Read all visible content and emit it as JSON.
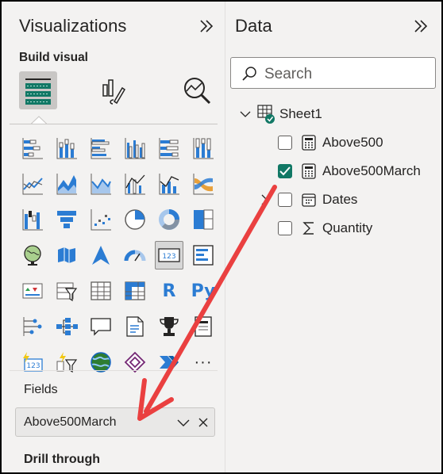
{
  "visualizations_pane": {
    "title": "Visualizations",
    "build_visual_label": "Build visual",
    "build_visual_buttons": [
      {
        "name": "build-visual",
        "icon": "table-fields-icon",
        "selected": true
      },
      {
        "name": "format-visual",
        "icon": "paintbrush-icon",
        "selected": false
      },
      {
        "name": "analytics",
        "icon": "magnifier-analytics-icon",
        "selected": false
      }
    ],
    "visual_types": [
      "stacked-bar-chart",
      "stacked-column-chart",
      "clustered-bar-chart",
      "clustered-column-chart",
      "100-stacked-bar-chart",
      "100-stacked-column-chart",
      "line-chart",
      "area-chart",
      "stacked-area-chart",
      "line-clustered-column-chart",
      "line-stacked-column-chart",
      "ribbon-chart",
      "waterfall-chart",
      "funnel-chart",
      "scatter-chart",
      "pie-chart",
      "donut-chart",
      "treemap",
      "map",
      "filled-map",
      "azure-map",
      "gauge",
      "card",
      "multi-row-card",
      "kpi",
      "slicer",
      "table",
      "matrix",
      "r-visual",
      "python-visual",
      "key-influencers",
      "decomposition-tree",
      "qa",
      "smart-narrative",
      "paginated-report",
      "metrics",
      "power-apps",
      "power-automate",
      "arcgis-map",
      "power-apps-diamond",
      "power-automate-chevron",
      "more-visuals"
    ],
    "r_label": "R",
    "py_label": "Py",
    "card_label": "123",
    "more_label": "···",
    "fields_label": "Fields",
    "field_well_value": "Above500March",
    "drill_through_label": "Drill through"
  },
  "data_pane": {
    "title": "Data",
    "search_placeholder": "Search",
    "table_name": "Sheet1",
    "fields": [
      {
        "label": "Above500",
        "checked": false,
        "icon": "calculator-icon"
      },
      {
        "label": "Above500March",
        "checked": true,
        "icon": "calculator-icon"
      },
      {
        "label": "Dates",
        "checked": false,
        "icon": "calendar-icon",
        "expandable": true
      },
      {
        "label": "Quantity",
        "checked": false,
        "icon": "sigma-icon"
      }
    ]
  },
  "colors": {
    "accent_blue": "#2b7cd3",
    "check_green": "#117865",
    "annotation_arrow": "#ea4040"
  }
}
